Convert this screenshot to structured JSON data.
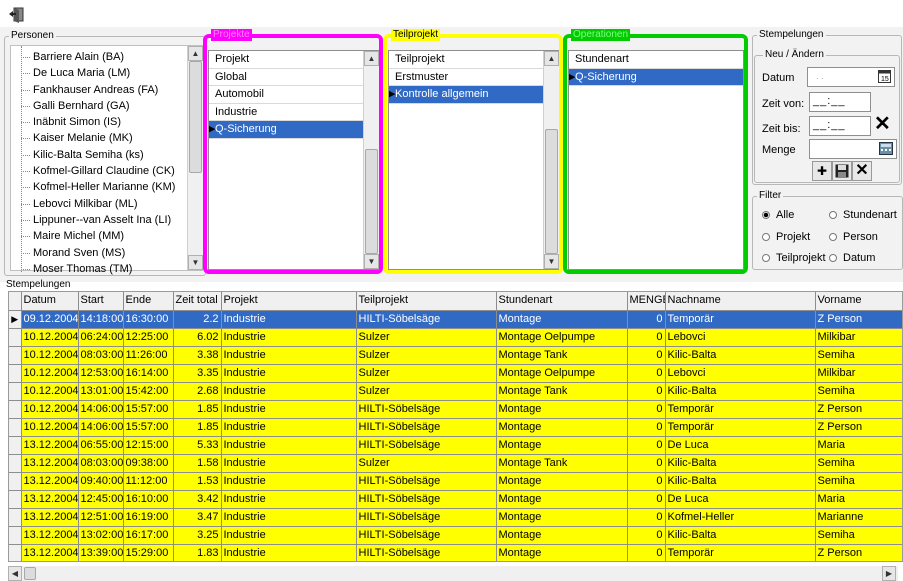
{
  "personen": {
    "title": "Personen",
    "items": [
      "Barriere Alain (BA)",
      "De Luca Maria (LM)",
      "Fankhauser Andreas (FA)",
      "Galli Bernhard (GA)",
      "Inäbnit Simon (IS)",
      "Kaiser Melanie (MK)",
      "Kilic-Balta Semiha (ks)",
      "Kofmel-Gillard Claudine (CK)",
      "Kofmel-Heller Marianne (KM)",
      "Lebovci Milkibar (ML)",
      "Lippuner--van Asselt Ina (LI)",
      "Maire Michel (MM)",
      "Morand Sven (MS)",
      "Moser Thomas (TM)"
    ]
  },
  "projekte": {
    "title": "Projekte",
    "color": "#ff00ff",
    "items": [
      "Projekt",
      "Global",
      "Automobil",
      "Industrie",
      "Q-Sicherung"
    ],
    "selected_index": 4
  },
  "teilprojekt": {
    "title": "Teilprojekt",
    "color": "#ffff00",
    "items": [
      "Teilprojekt",
      "Erstmuster",
      "Kontrolle allgemein"
    ],
    "selected_index": 2
  },
  "operationen": {
    "title": "Operationen",
    "color": "#00cc00",
    "items": [
      "Stundenart",
      "Q-Sicherung"
    ],
    "selected_index": 1
  },
  "stempelungen_form": {
    "title": "Stempelungen",
    "subtitle": "Neu / Ändern",
    "datum_label": "Datum",
    "datum_value": "  . .",
    "zeit_von_label": "Zeit von:",
    "zeit_von_value": "__:__",
    "zeit_bis_label": "Zeit bis:",
    "zeit_bis_value": "__:__",
    "menge_label": "Menge"
  },
  "filter": {
    "title": "Filter",
    "options": [
      "Alle",
      "Stundenart",
      "Projekt",
      "Person",
      "Teilprojekt",
      "Datum"
    ],
    "selected": "Alle"
  },
  "grid": {
    "title": "Stempelungen",
    "columns": [
      "Datum",
      "Start",
      "Ende",
      "Zeit total",
      "Projekt",
      "Teilprojekt",
      "Stundenart",
      "MENGE",
      "Nachname",
      "Vorname"
    ],
    "rows": [
      [
        "09.12.2004",
        "14:18:00",
        "16:30:00",
        "2.2",
        "Industrie",
        "HILTI-Söbelsäge",
        "Montage",
        "0",
        "Temporär",
        "Z Person"
      ],
      [
        "10.12.2004",
        "06:24:00",
        "12:25:00",
        "6.02",
        "Industrie",
        "Sulzer",
        "Montage Oelpumpe",
        "0",
        "Lebovci",
        "Milkibar"
      ],
      [
        "10.12.2004",
        "08:03:00",
        "11:26:00",
        "3.38",
        "Industrie",
        "Sulzer",
        "Montage Tank",
        "0",
        "Kilic-Balta",
        "Semiha"
      ],
      [
        "10.12.2004",
        "12:53:00",
        "16:14:00",
        "3.35",
        "Industrie",
        "Sulzer",
        "Montage Oelpumpe",
        "0",
        "Lebovci",
        "Milkibar"
      ],
      [
        "10.12.2004",
        "13:01:00",
        "15:42:00",
        "2.68",
        "Industrie",
        "Sulzer",
        "Montage Tank",
        "0",
        "Kilic-Balta",
        "Semiha"
      ],
      [
        "10.12.2004",
        "14:06:00",
        "15:57:00",
        "1.85",
        "Industrie",
        "HILTI-Söbelsäge",
        "Montage",
        "0",
        "Temporär",
        "Z Person"
      ],
      [
        "10.12.2004",
        "14:06:00",
        "15:57:00",
        "1.85",
        "Industrie",
        "HILTI-Söbelsäge",
        "Montage",
        "0",
        "Temporär",
        "Z Person"
      ],
      [
        "13.12.2004",
        "06:55:00",
        "12:15:00",
        "5.33",
        "Industrie",
        "HILTI-Söbelsäge",
        "Montage",
        "0",
        "De Luca",
        "Maria"
      ],
      [
        "13.12.2004",
        "08:03:00",
        "09:38:00",
        "1.58",
        "Industrie",
        "Sulzer",
        "Montage Tank",
        "0",
        "Kilic-Balta",
        "Semiha"
      ],
      [
        "13.12.2004",
        "09:40:00",
        "11:12:00",
        "1.53",
        "Industrie",
        "HILTI-Söbelsäge",
        "Montage",
        "0",
        "Kilic-Balta",
        "Semiha"
      ],
      [
        "13.12.2004",
        "12:45:00",
        "16:10:00",
        "3.42",
        "Industrie",
        "HILTI-Söbelsäge",
        "Montage",
        "0",
        "De Luca",
        "Maria"
      ],
      [
        "13.12.2004",
        "12:51:00",
        "16:19:00",
        "3.47",
        "Industrie",
        "HILTI-Söbelsäge",
        "Montage",
        "0",
        "Kofmel-Heller",
        "Marianne"
      ],
      [
        "13.12.2004",
        "13:02:00",
        "16:17:00",
        "3.25",
        "Industrie",
        "HILTI-Söbelsäge",
        "Montage",
        "0",
        "Kilic-Balta",
        "Semiha"
      ],
      [
        "13.12.2004",
        "13:39:00",
        "15:29:00",
        "1.83",
        "Industrie",
        "HILTI-Söbelsäge",
        "Montage",
        "0",
        "Temporär",
        "Z Person"
      ]
    ],
    "selected_row": 0,
    "row_color": "#ffff00",
    "selected_color": "#316ac5"
  },
  "icons": {
    "toolbar": "exit-door-icon",
    "calendar": "calendar-icon",
    "clear_time": "x-icon",
    "calculator": "calculator-icon",
    "add": "add-icon",
    "save": "save-disk-icon",
    "cancel": "x-icon"
  }
}
